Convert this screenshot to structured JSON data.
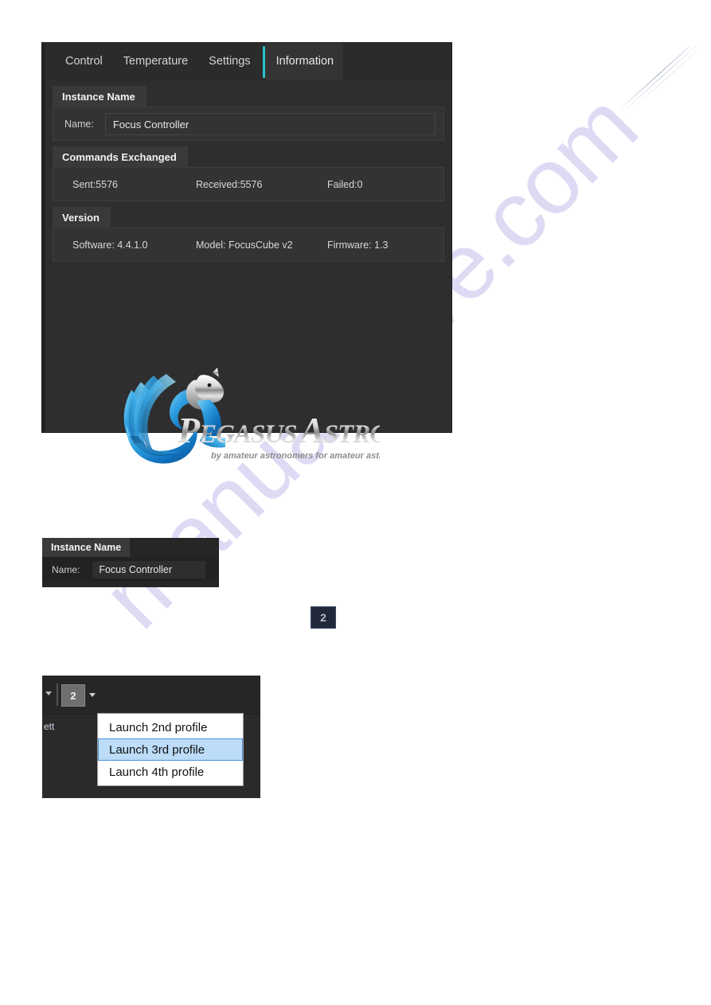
{
  "watermark": {
    "text": "manualshive.com"
  },
  "app_window": {
    "tabs": [
      {
        "label": "Control",
        "active": false
      },
      {
        "label": "Temperature",
        "active": false
      },
      {
        "label": "Settings",
        "active": false
      },
      {
        "label": "Information",
        "active": true
      }
    ],
    "accent_color": "#27c4c8",
    "groups": {
      "instance_name": {
        "caption": "Instance Name",
        "name_label": "Name:",
        "name_value": "Focus Controller"
      },
      "commands_exchanged": {
        "caption": "Commands Exchanged",
        "sent": "Sent:5576",
        "received": "Received:5576",
        "failed": "Failed:0"
      },
      "version": {
        "caption": "Version",
        "software": "Software: 4.4.1.0",
        "model": "Model: FocusCube v2",
        "firmware": "Firmware: 1.3"
      }
    },
    "logo": {
      "name": "pegasus-astro-logo",
      "wordmark_part1": "Pegasus",
      "wordmark_part2": "Astro",
      "tagline": "by amateur astronomers for amateur astronomers"
    }
  },
  "mini_panel": {
    "caption": "Instance Name",
    "name_label": "Name:",
    "name_value": "Focus Controller"
  },
  "badge": {
    "value": "2"
  },
  "dropdown_window": {
    "button_label": "2",
    "partial_text": "ett",
    "menu_items": [
      {
        "label": "Launch 2nd profile",
        "selected": false
      },
      {
        "label": "Launch 3rd profile",
        "selected": true
      },
      {
        "label": "Launch 4th profile",
        "selected": false
      }
    ],
    "highlight_color": "#bcdcf7"
  }
}
